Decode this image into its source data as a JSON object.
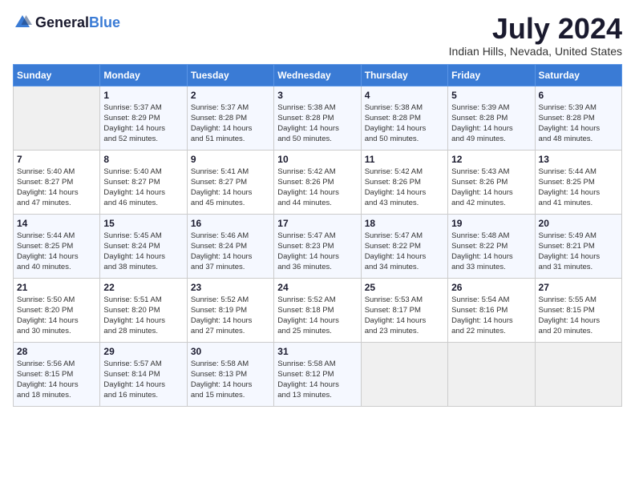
{
  "header": {
    "logo_general": "General",
    "logo_blue": "Blue",
    "month_year": "July 2024",
    "location": "Indian Hills, Nevada, United States"
  },
  "days_of_week": [
    "Sunday",
    "Monday",
    "Tuesday",
    "Wednesday",
    "Thursday",
    "Friday",
    "Saturday"
  ],
  "weeks": [
    [
      {
        "day": "",
        "info": ""
      },
      {
        "day": "1",
        "info": "Sunrise: 5:37 AM\nSunset: 8:29 PM\nDaylight: 14 hours\nand 52 minutes."
      },
      {
        "day": "2",
        "info": "Sunrise: 5:37 AM\nSunset: 8:28 PM\nDaylight: 14 hours\nand 51 minutes."
      },
      {
        "day": "3",
        "info": "Sunrise: 5:38 AM\nSunset: 8:28 PM\nDaylight: 14 hours\nand 50 minutes."
      },
      {
        "day": "4",
        "info": "Sunrise: 5:38 AM\nSunset: 8:28 PM\nDaylight: 14 hours\nand 50 minutes."
      },
      {
        "day": "5",
        "info": "Sunrise: 5:39 AM\nSunset: 8:28 PM\nDaylight: 14 hours\nand 49 minutes."
      },
      {
        "day": "6",
        "info": "Sunrise: 5:39 AM\nSunset: 8:28 PM\nDaylight: 14 hours\nand 48 minutes."
      }
    ],
    [
      {
        "day": "7",
        "info": "Sunrise: 5:40 AM\nSunset: 8:27 PM\nDaylight: 14 hours\nand 47 minutes."
      },
      {
        "day": "8",
        "info": "Sunrise: 5:40 AM\nSunset: 8:27 PM\nDaylight: 14 hours\nand 46 minutes."
      },
      {
        "day": "9",
        "info": "Sunrise: 5:41 AM\nSunset: 8:27 PM\nDaylight: 14 hours\nand 45 minutes."
      },
      {
        "day": "10",
        "info": "Sunrise: 5:42 AM\nSunset: 8:26 PM\nDaylight: 14 hours\nand 44 minutes."
      },
      {
        "day": "11",
        "info": "Sunrise: 5:42 AM\nSunset: 8:26 PM\nDaylight: 14 hours\nand 43 minutes."
      },
      {
        "day": "12",
        "info": "Sunrise: 5:43 AM\nSunset: 8:26 PM\nDaylight: 14 hours\nand 42 minutes."
      },
      {
        "day": "13",
        "info": "Sunrise: 5:44 AM\nSunset: 8:25 PM\nDaylight: 14 hours\nand 41 minutes."
      }
    ],
    [
      {
        "day": "14",
        "info": "Sunrise: 5:44 AM\nSunset: 8:25 PM\nDaylight: 14 hours\nand 40 minutes."
      },
      {
        "day": "15",
        "info": "Sunrise: 5:45 AM\nSunset: 8:24 PM\nDaylight: 14 hours\nand 38 minutes."
      },
      {
        "day": "16",
        "info": "Sunrise: 5:46 AM\nSunset: 8:24 PM\nDaylight: 14 hours\nand 37 minutes."
      },
      {
        "day": "17",
        "info": "Sunrise: 5:47 AM\nSunset: 8:23 PM\nDaylight: 14 hours\nand 36 minutes."
      },
      {
        "day": "18",
        "info": "Sunrise: 5:47 AM\nSunset: 8:22 PM\nDaylight: 14 hours\nand 34 minutes."
      },
      {
        "day": "19",
        "info": "Sunrise: 5:48 AM\nSunset: 8:22 PM\nDaylight: 14 hours\nand 33 minutes."
      },
      {
        "day": "20",
        "info": "Sunrise: 5:49 AM\nSunset: 8:21 PM\nDaylight: 14 hours\nand 31 minutes."
      }
    ],
    [
      {
        "day": "21",
        "info": "Sunrise: 5:50 AM\nSunset: 8:20 PM\nDaylight: 14 hours\nand 30 minutes."
      },
      {
        "day": "22",
        "info": "Sunrise: 5:51 AM\nSunset: 8:20 PM\nDaylight: 14 hours\nand 28 minutes."
      },
      {
        "day": "23",
        "info": "Sunrise: 5:52 AM\nSunset: 8:19 PM\nDaylight: 14 hours\nand 27 minutes."
      },
      {
        "day": "24",
        "info": "Sunrise: 5:52 AM\nSunset: 8:18 PM\nDaylight: 14 hours\nand 25 minutes."
      },
      {
        "day": "25",
        "info": "Sunrise: 5:53 AM\nSunset: 8:17 PM\nDaylight: 14 hours\nand 23 minutes."
      },
      {
        "day": "26",
        "info": "Sunrise: 5:54 AM\nSunset: 8:16 PM\nDaylight: 14 hours\nand 22 minutes."
      },
      {
        "day": "27",
        "info": "Sunrise: 5:55 AM\nSunset: 8:15 PM\nDaylight: 14 hours\nand 20 minutes."
      }
    ],
    [
      {
        "day": "28",
        "info": "Sunrise: 5:56 AM\nSunset: 8:15 PM\nDaylight: 14 hours\nand 18 minutes."
      },
      {
        "day": "29",
        "info": "Sunrise: 5:57 AM\nSunset: 8:14 PM\nDaylight: 14 hours\nand 16 minutes."
      },
      {
        "day": "30",
        "info": "Sunrise: 5:58 AM\nSunset: 8:13 PM\nDaylight: 14 hours\nand 15 minutes."
      },
      {
        "day": "31",
        "info": "Sunrise: 5:58 AM\nSunset: 8:12 PM\nDaylight: 14 hours\nand 13 minutes."
      },
      {
        "day": "",
        "info": ""
      },
      {
        "day": "",
        "info": ""
      },
      {
        "day": "",
        "info": ""
      }
    ]
  ]
}
